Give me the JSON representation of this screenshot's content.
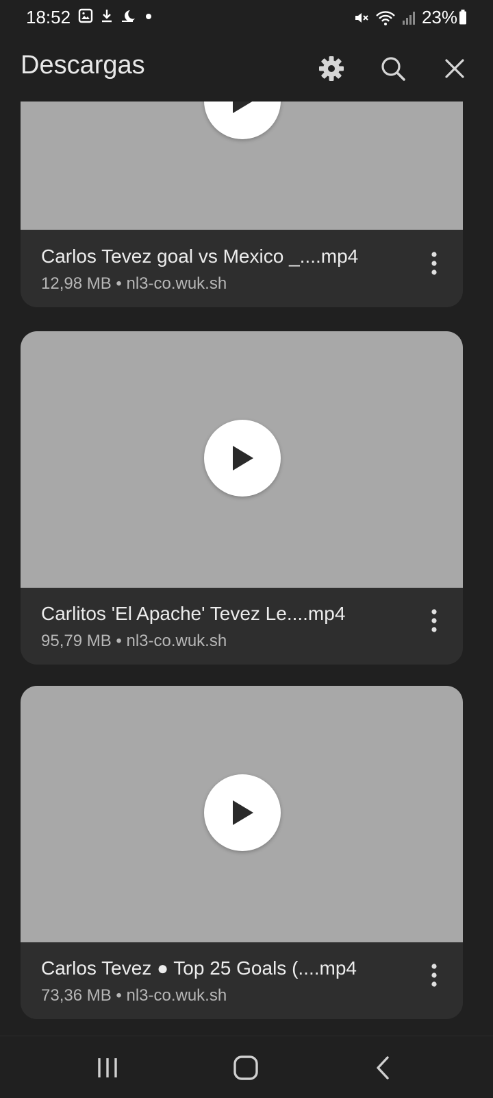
{
  "status_bar": {
    "time": "18:52",
    "left_icons": [
      "image-icon",
      "download-icon",
      "dnd-moon-icon",
      "dot-icon"
    ],
    "right_icons": [
      "mute-icon",
      "wifi-icon",
      "signal-icon"
    ],
    "battery": "23%"
  },
  "app_bar": {
    "title": "Descargas",
    "actions": [
      "gear-icon",
      "search-icon",
      "close-icon"
    ]
  },
  "downloads": [
    {
      "title": "Carlos Tevez goal vs Mexico _....mp4",
      "meta": "12,98 MB • nl3-co.wuk.sh"
    },
    {
      "title": "Carlitos 'El Apache' Tevez Le....mp4",
      "meta": "95,79 MB • nl3-co.wuk.sh"
    },
    {
      "title": "Carlos Tevez ● Top 25 Goals (....mp4",
      "meta": "73,36 MB • nl3-co.wuk.sh"
    }
  ],
  "nav_bar": [
    "recents-icon",
    "home-icon",
    "back-icon"
  ],
  "colors": {
    "background": "#202020",
    "card": "#2e2e2e",
    "thumbnail": "#a8a8a8",
    "text_primary": "#ececec",
    "text_secondary": "#b7b7b7"
  }
}
